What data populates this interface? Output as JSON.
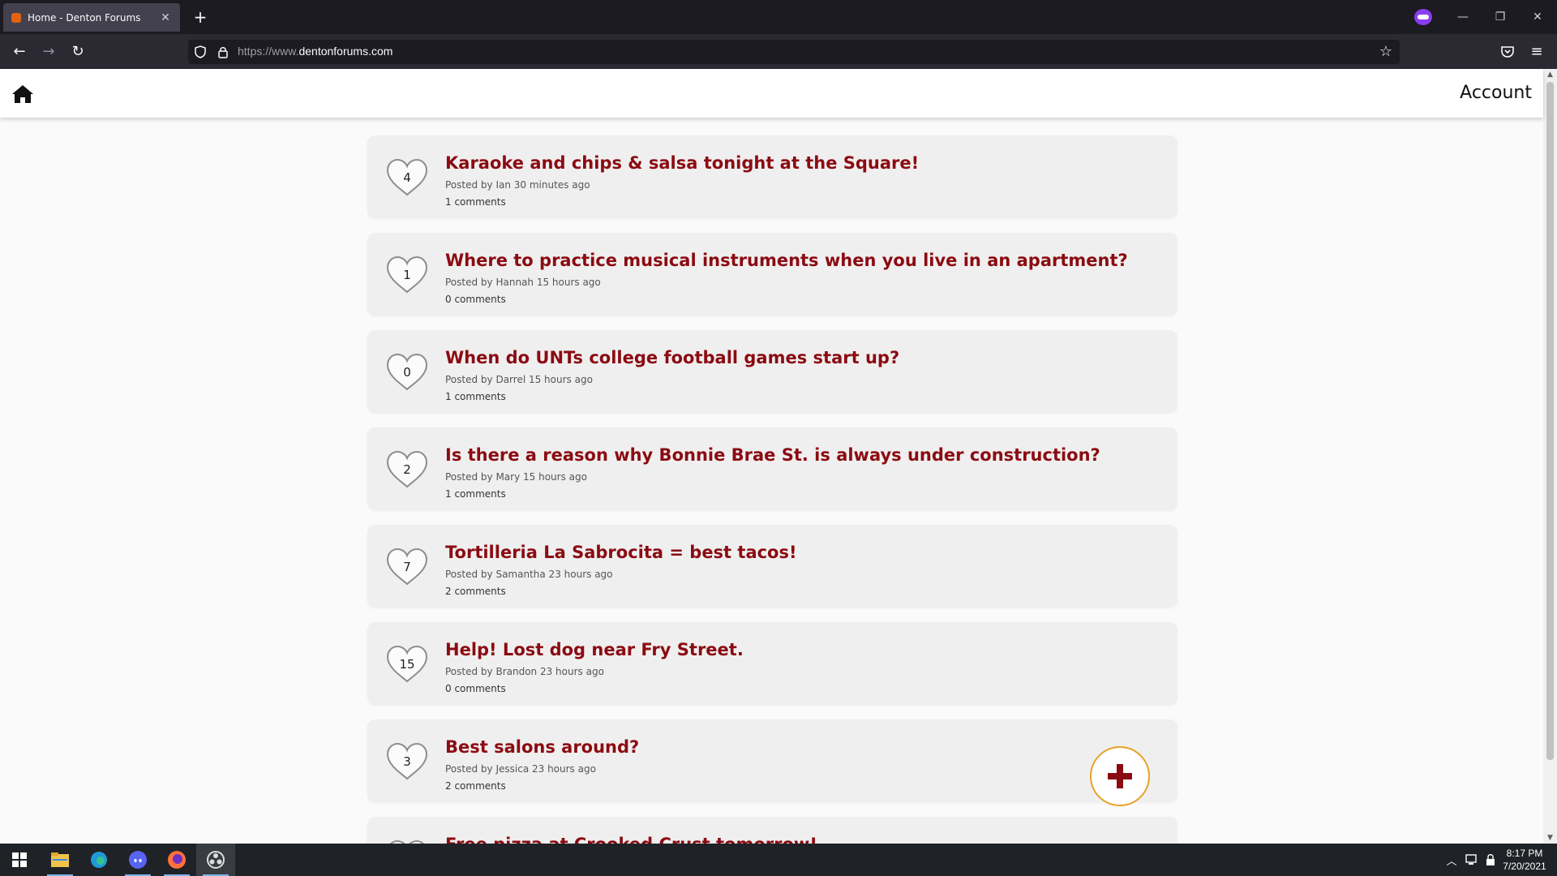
{
  "browser": {
    "tab_title": "Home - Denton Forums",
    "url_protocol": "https://www.",
    "url_host": "dentonforums.com"
  },
  "site": {
    "account_label": "Account"
  },
  "posts": [
    {
      "likes": "4",
      "title": "Karaoke and chips & salsa tonight at the Square!",
      "meta": "Posted by Ian 30 minutes ago",
      "comments": "1 comments"
    },
    {
      "likes": "1",
      "title": "Where to practice musical instruments when you live in an apartment?",
      "meta": "Posted by Hannah 15 hours ago",
      "comments": "0 comments"
    },
    {
      "likes": "0",
      "title": "When do UNTs college football games start up?",
      "meta": "Posted by Darrel 15 hours ago",
      "comments": "1 comments"
    },
    {
      "likes": "2",
      "title": "Is there a reason why Bonnie Brae St. is always under construction?",
      "meta": "Posted by Mary 15 hours ago",
      "comments": "1 comments"
    },
    {
      "likes": "7",
      "title": "Tortilleria La Sabrocita = best tacos!",
      "meta": "Posted by Samantha 23 hours ago",
      "comments": "2 comments"
    },
    {
      "likes": "15",
      "title": "Help! Lost dog near Fry Street.",
      "meta": "Posted by Brandon 23 hours ago",
      "comments": "0 comments"
    },
    {
      "likes": "3",
      "title": "Best salons around?",
      "meta": "Posted by Jessica 23 hours ago",
      "comments": "2 comments"
    },
    {
      "likes": "",
      "title": "Free pizza at Crooked Crust tomorrow!",
      "meta": "",
      "comments": ""
    }
  ],
  "colors": {
    "title": "#8b0b12",
    "fab_border": "#e7a22a",
    "card_bg": "#f0efef"
  },
  "taskbar": {
    "time": "8:17 PM",
    "date": "7/20/2021"
  }
}
